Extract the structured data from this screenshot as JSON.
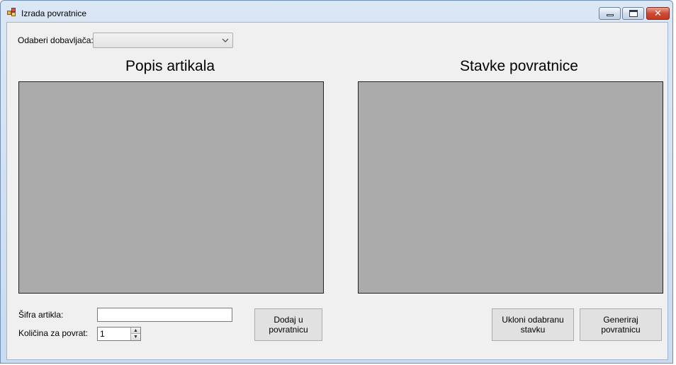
{
  "window": {
    "title": "Izrada povratnice"
  },
  "supplier": {
    "label": "Odaberi dobavljača:",
    "selected": ""
  },
  "left_panel": {
    "heading": "Popis artikala"
  },
  "right_panel": {
    "heading": "Stavke povratnice"
  },
  "form": {
    "sifra_label": "Šifra artikla:",
    "sifra_value": "",
    "kolicina_label": "Količina za povrat:",
    "kolicina_value": "1"
  },
  "buttons": {
    "dodaj": "Dodaj u\npovratnicu",
    "ukloni": "Ukloni odabranu\nstavku",
    "generiraj": "Generiraj povratnicu"
  }
}
